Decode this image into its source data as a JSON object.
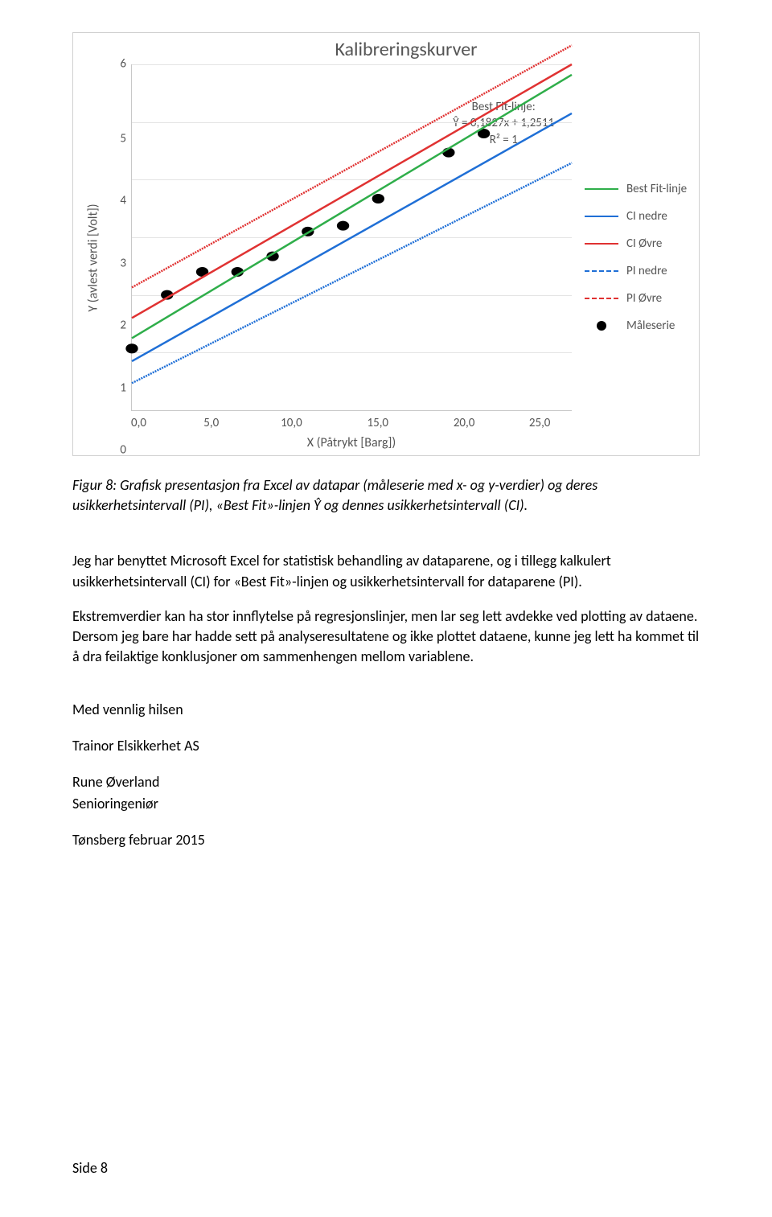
{
  "chart_data": {
    "type": "line",
    "title": "Kalibreringskurver",
    "xlabel": "X (Påtrykt [Barg])",
    "ylabel": "Y (avlest verdi [Volt])",
    "xlim": [
      0,
      25
    ],
    "ylim": [
      0,
      6
    ],
    "xticks": [
      "0,0",
      "5,0",
      "10,0",
      "15,0",
      "20,0",
      "25,0"
    ],
    "yticks": [
      "0",
      "1",
      "2",
      "3",
      "4",
      "5",
      "6"
    ],
    "annotation": {
      "lines": [
        "Best Fit-linje:",
        "Ŷ = 0,1827x + 1,2511",
        "R² = 1"
      ]
    },
    "legend": [
      {
        "name": "Best Fit-linje",
        "color": "#2fae4a",
        "style": "solid"
      },
      {
        "name": "CI nedre",
        "color": "#1f6fd6",
        "style": "solid"
      },
      {
        "name": "CI Øvre",
        "color": "#e03232",
        "style": "solid"
      },
      {
        "name": "PI nedre",
        "color": "#1f6fd6",
        "style": "dashed"
      },
      {
        "name": "PI Øvre",
        "color": "#e03232",
        "style": "dashed"
      },
      {
        "name": "Måleserie",
        "color": "#000000",
        "style": "dot"
      }
    ],
    "series": [
      {
        "name": "Måleserie",
        "type": "scatter",
        "x": [
          0,
          2,
          4,
          6,
          8,
          10,
          12,
          14,
          18,
          20
        ],
        "y": [
          1.07,
          2.0,
          2.4,
          2.4,
          2.67,
          3.1,
          3.2,
          3.67,
          4.47,
          4.8
        ]
      },
      {
        "name": "Best Fit-linje",
        "type": "line",
        "color": "#2fae4a",
        "style": "solid",
        "x": [
          0,
          25
        ],
        "y": [
          1.25,
          5.82
        ]
      },
      {
        "name": "CI nedre",
        "type": "line",
        "color": "#1f6fd6",
        "style": "solid",
        "x": [
          0,
          25
        ],
        "y": [
          0.85,
          5.15
        ]
      },
      {
        "name": "CI Øvre",
        "type": "line",
        "color": "#e03232",
        "style": "solid",
        "x": [
          0,
          25
        ],
        "y": [
          1.6,
          6.0
        ]
      },
      {
        "name": "PI nedre",
        "type": "line",
        "color": "#1f6fd6",
        "style": "dashed",
        "x": [
          0,
          25
        ],
        "y": [
          0.47,
          4.29
        ]
      },
      {
        "name": "PI Øvre",
        "type": "line",
        "color": "#e03232",
        "style": "dashed",
        "x": [
          0,
          25
        ],
        "y": [
          2.13,
          6.33
        ]
      }
    ]
  },
  "caption": "Figur 8: Grafisk presentasjon fra Excel av datapar (måleserie med x- og y-verdier) og deres usikkerhetsintervall (PI), «Best Fit»-linjen Ŷ og dennes usikkerhetsintervall (CI).",
  "body": {
    "p1": "Jeg har benyttet Microsoft Excel for statistisk behandling av dataparene, og i tillegg kalkulert usikkerhetsintervall (CI) for «Best Fit»-linjen og usikkerhetsintervall for dataparene (PI).",
    "p2": "Ekstremverdier kan ha stor innflytelse på regresjonslinjer, men lar seg lett avdekke ved plotting av dataene. Dersom jeg bare har hadde sett på analyseresultatene og ikke plottet dataene, kunne jeg lett ha kommet til å dra feilaktige konklusjoner om sammenhengen mellom variablene."
  },
  "signoff": {
    "greeting": "Med vennlig hilsen",
    "company": "Trainor Elsikkerhet AS",
    "name": "Rune Øverland",
    "role": "Senioringeniør",
    "place_date": "Tønsberg februar 2015"
  },
  "footer": "Side 8"
}
